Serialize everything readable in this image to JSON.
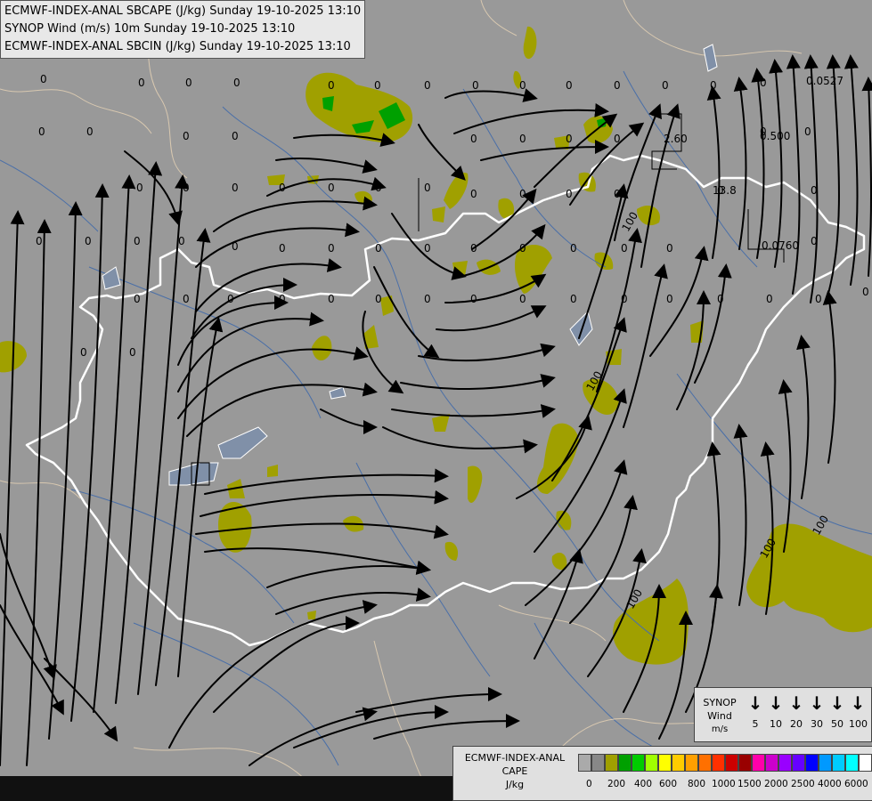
{
  "header": {
    "line1": "ECMWF-INDEX-ANAL SBCAPE (J/kg) Sunday 19-10-2025 13:10",
    "line2": "SYNOP Wind (m/s) 10m Sunday 19-10-2025 13:10",
    "line3": "ECMWF-INDEX-ANAL SBCIN (J/kg) Sunday 19-10-2025 13:10"
  },
  "colors": {
    "background": "#999999",
    "cape_low": "#a0a000",
    "cape_mid": "#00a000",
    "border": "#ffffff",
    "rivers": "#4a6fa8",
    "streamlines": "#000000"
  },
  "map_labels": [
    "0",
    "0",
    "0",
    "0",
    "0",
    "0",
    "0",
    "0",
    "0",
    "0",
    "0",
    "0",
    "0",
    "0",
    "0",
    "0",
    "0",
    "0",
    "0",
    "0",
    "0",
    "0",
    "0",
    "0",
    "0",
    "0",
    "0",
    "0",
    "0",
    "0",
    "0",
    "0",
    "0",
    "0",
    "0",
    "0",
    "0",
    "0",
    "0",
    "0",
    "0",
    "0",
    "0",
    "0",
    "0",
    "0",
    "0",
    "0",
    "0",
    "0",
    "0",
    "0",
    "0",
    "0",
    "0",
    "0",
    "0",
    "0",
    "0",
    "0",
    "0",
    "0",
    "0",
    "0",
    "0",
    "0",
    "0",
    "0",
    "0",
    "0",
    "100",
    "100",
    "100",
    "100",
    "100",
    "2.60",
    "13.8",
    "0.0527",
    "0.500",
    "0.0760"
  ],
  "synop_legend": {
    "title": [
      "SYNOP",
      "Wind",
      "m/s"
    ],
    "values": [
      "5",
      "10",
      "20",
      "30",
      "50",
      "100"
    ]
  },
  "cape_legend": {
    "title": [
      "ECMWF-INDEX-ANAL",
      "CAPE",
      "J/kg"
    ],
    "colors": [
      "#aaaaaa",
      "#888888",
      "#a0a000",
      "#00a000",
      "#00cc00",
      "#a0ff00",
      "#ffff00",
      "#ffcc00",
      "#ffa000",
      "#ff7000",
      "#ff3000",
      "#cc0000",
      "#990000",
      "#ff00aa",
      "#cc00cc",
      "#9900ff",
      "#6600ff",
      "#0000ff",
      "#0099ff",
      "#00ccff",
      "#00ffff",
      "#ffffff"
    ],
    "ticks": [
      "0",
      "200",
      "400",
      "600",
      "800",
      "1000",
      "1500",
      "2000",
      "2500",
      "4000",
      "6000"
    ]
  }
}
